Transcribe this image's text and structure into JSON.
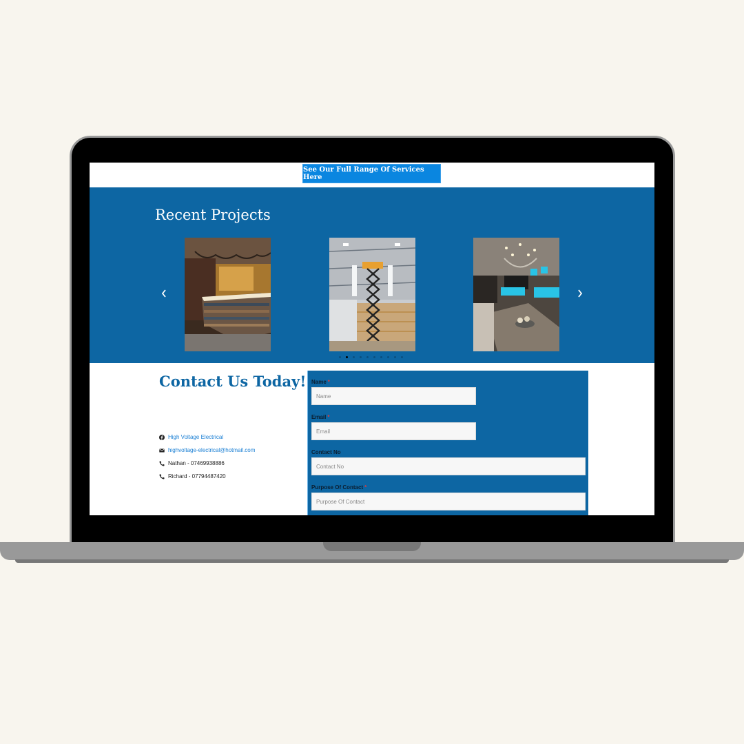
{
  "colors": {
    "background": "#f8f5ee",
    "brand_blue": "#0d66a3",
    "button_blue": "#0a86e0",
    "link_blue": "#1a7fd4",
    "required_red": "#e03a3a"
  },
  "top_strip": {
    "services_button_label": "See Our Full Range Of Services Here"
  },
  "projects": {
    "title": "Recent Projects",
    "prev_icon": "chevron-left-icon",
    "next_icon": "chevron-right-icon",
    "slides": [
      {
        "alt": "Bar with illuminated wooden counter and hanging rope lights"
      },
      {
        "alt": "Warehouse ceiling lighting installation with scissor lift"
      },
      {
        "alt": "Kitchen with chandelier and blue LED under-cabinet lighting"
      }
    ],
    "dots_total": 10,
    "dots_active_index": 1
  },
  "contact": {
    "title": "Contact Us Today!",
    "items": [
      {
        "icon": "facebook-icon",
        "text": "High Voltage Electrical",
        "link": true
      },
      {
        "icon": "envelope-icon",
        "text": "highvoltage-electrical@hotmail.com",
        "link": true
      },
      {
        "icon": "phone-icon",
        "text": "Nathan - 07469938886",
        "link": false
      },
      {
        "icon": "phone-icon",
        "text": "Richard - 07794487420",
        "link": false
      }
    ]
  },
  "form": {
    "fields": [
      {
        "label": "Name",
        "required": "*",
        "placeholder": "Name"
      },
      {
        "label": "Email",
        "required": "*",
        "placeholder": "Email"
      },
      {
        "label": "Contact No",
        "required": "",
        "placeholder": "Contact No"
      },
      {
        "label": "Purpose Of Contact",
        "required": "*",
        "placeholder": "Purpose Of Contact"
      }
    ]
  }
}
